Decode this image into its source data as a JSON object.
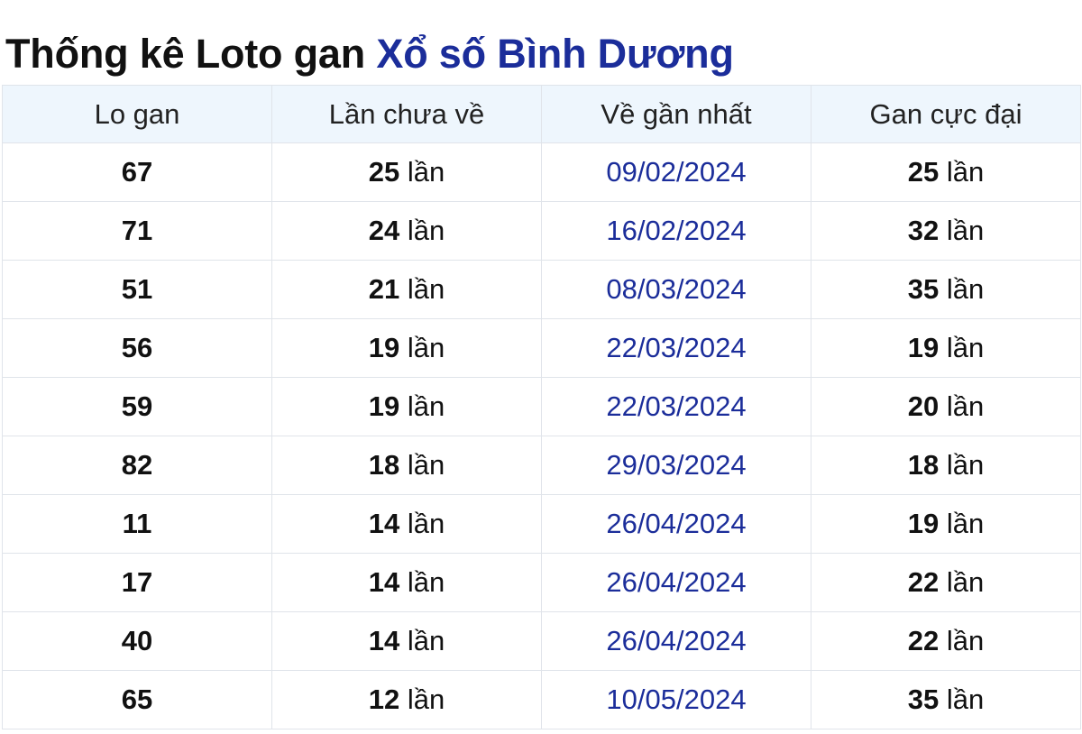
{
  "title": {
    "prefix": "Thống kê Loto gan",
    "place": "Xổ số Bình Dương"
  },
  "table": {
    "headers": [
      "Lo gan",
      "Lần chưa về",
      "Về gần nhất",
      "Gan cực đại"
    ],
    "rows": [
      {
        "lo": "67",
        "missed": "25",
        "missed_unit": "lần",
        "last": "09/02/2024",
        "max": "25",
        "max_unit": "lần"
      },
      {
        "lo": "71",
        "missed": "24",
        "missed_unit": "lần",
        "last": "16/02/2024",
        "max": "32",
        "max_unit": "lần"
      },
      {
        "lo": "51",
        "missed": "21",
        "missed_unit": "lần",
        "last": "08/03/2024",
        "max": "35",
        "max_unit": "lần"
      },
      {
        "lo": "56",
        "missed": "19",
        "missed_unit": "lần",
        "last": "22/03/2024",
        "max": "19",
        "max_unit": "lần"
      },
      {
        "lo": "59",
        "missed": "19",
        "missed_unit": "lần",
        "last": "22/03/2024",
        "max": "20",
        "max_unit": "lần"
      },
      {
        "lo": "82",
        "missed": "18",
        "missed_unit": "lần",
        "last": "29/03/2024",
        "max": "18",
        "max_unit": "lần"
      },
      {
        "lo": "11",
        "missed": "14",
        "missed_unit": "lần",
        "last": "26/04/2024",
        "max": "19",
        "max_unit": "lần"
      },
      {
        "lo": "17",
        "missed": "14",
        "missed_unit": "lần",
        "last": "26/04/2024",
        "max": "22",
        "max_unit": "lần"
      },
      {
        "lo": "40",
        "missed": "14",
        "missed_unit": "lần",
        "last": "26/04/2024",
        "max": "22",
        "max_unit": "lần"
      },
      {
        "lo": "65",
        "missed": "12",
        "missed_unit": "lần",
        "last": "10/05/2024",
        "max": "35",
        "max_unit": "lần"
      }
    ]
  },
  "colors": {
    "accent": "#1b2d9a",
    "header_bg": "#eef6fd",
    "border": "#e0e4ea"
  }
}
